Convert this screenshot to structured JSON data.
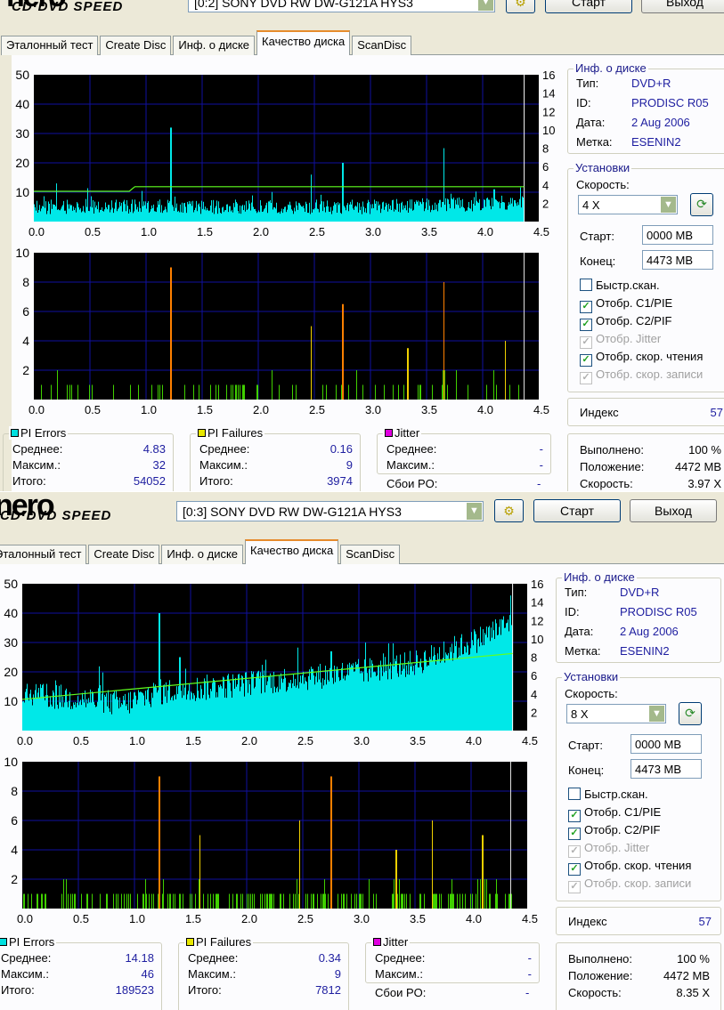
{
  "panels": [
    {
      "logo": "nero",
      "logo_sub": "CD·DVD SPEED",
      "drive": "[0:2]  SONY DVD RW DW-G121A HYS3",
      "start_btn": "Старт",
      "exit_btn": "Выход",
      "tabs": [
        "Эталонный тест",
        "Create Disc",
        "Инф. о диске",
        "Качество диска",
        "ScanDisc"
      ],
      "active_tab": 3,
      "info": {
        "title": "Инф. о диске",
        "type_l": "Тип:",
        "type": "DVD+R",
        "id_l": "ID:",
        "id": "PRODISC R05",
        "date_l": "Дата:",
        "date": "2 Aug 2006",
        "label_l": "Метка:",
        "label": "ESENIN2"
      },
      "settings": {
        "title": "Установки",
        "speed_l": "Скорость:",
        "speed": "4 X",
        "start_l": "Старт:",
        "start": "0000 MB",
        "end_l": "Конец:",
        "end": "4473 MB",
        "checks": [
          {
            "label": "Быстр.скан.",
            "checked": false,
            "disabled": false
          },
          {
            "label": "Отобр. C1/PIE",
            "checked": true,
            "disabled": false
          },
          {
            "label": "Отобр. C2/PIF",
            "checked": true,
            "disabled": false
          },
          {
            "label": "Отобр. Jitter",
            "checked": true,
            "disabled": true
          },
          {
            "label": "Отобр. скор. чтения",
            "checked": true,
            "disabled": false
          },
          {
            "label": "Отобр. скор. записи",
            "checked": true,
            "disabled": true
          }
        ]
      },
      "index_l": "Индекс",
      "index": "57",
      "progress": {
        "done_l": "Выполнено:",
        "done": "100 %",
        "pos_l": "Положение:",
        "pos": "4472 MB",
        "spd_l": "Скорость:",
        "spd": "3.97 X"
      },
      "pie": {
        "title": "PI Errors",
        "avg_l": "Среднее:",
        "avg": "4.83",
        "max_l": "Максим.:",
        "max": "32",
        "tot_l": "Итого:",
        "tot": "54052"
      },
      "pif": {
        "title": "PI Failures",
        "avg_l": "Среднее:",
        "avg": "0.16",
        "max_l": "Максим.:",
        "max": "9",
        "tot_l": "Итого:",
        "tot": "3974"
      },
      "jit": {
        "title": "Jitter",
        "avg_l": "Среднее:",
        "avg": "-",
        "max_l": "Максим.:",
        "max": "-",
        "po_l": "Сбои PO:",
        "po": "-"
      }
    },
    {
      "logo": "nero",
      "logo_sub": "CD·DVD SPEED",
      "drive": "[0:3]  SONY DVD RW DW-G121A HYS3",
      "start_btn": "Старт",
      "exit_btn": "Выход",
      "tabs": [
        "Эталонный тест",
        "Create Disc",
        "Инф. о диске",
        "Качество диска",
        "ScanDisc"
      ],
      "active_tab": 3,
      "info": {
        "title": "Инф. о диске",
        "type_l": "Тип:",
        "type": "DVD+R",
        "id_l": "ID:",
        "id": "PRODISC R05",
        "date_l": "Дата:",
        "date": "2 Aug 2006",
        "label_l": "Метка:",
        "label": "ESENIN2"
      },
      "settings": {
        "title": "Установки",
        "speed_l": "Скорость:",
        "speed": "8 X",
        "start_l": "Старт:",
        "start": "0000 MB",
        "end_l": "Конец:",
        "end": "4473 MB",
        "checks": [
          {
            "label": "Быстр.скан.",
            "checked": false,
            "disabled": false
          },
          {
            "label": "Отобр. C1/PIE",
            "checked": true,
            "disabled": false
          },
          {
            "label": "Отобр. C2/PIF",
            "checked": true,
            "disabled": false
          },
          {
            "label": "Отобр. Jitter",
            "checked": true,
            "disabled": true
          },
          {
            "label": "Отобр. скор. чтения",
            "checked": true,
            "disabled": false
          },
          {
            "label": "Отобр. скор. записи",
            "checked": true,
            "disabled": true
          }
        ]
      },
      "index_l": "Индекс",
      "index": "57",
      "progress": {
        "done_l": "Выполнено:",
        "done": "100 %",
        "pos_l": "Положение:",
        "pos": "4472 MB",
        "spd_l": "Скорость:",
        "spd": "8.35 X"
      },
      "pie": {
        "title": "PI Errors",
        "avg_l": "Среднее:",
        "avg": "14.18",
        "max_l": "Максим.:",
        "max": "46",
        "tot_l": "Итого:",
        "tot": "189523"
      },
      "pif": {
        "title": "PI Failures",
        "avg_l": "Среднее:",
        "avg": "0.34",
        "max_l": "Максим.:",
        "max": "9",
        "tot_l": "Итого:",
        "tot": "7812"
      },
      "jit": {
        "title": "Jitter",
        "avg_l": "Среднее:",
        "avg": "-",
        "max_l": "Максим.:",
        "max": "-",
        "po_l": "Сбои PO:",
        "po": "-"
      }
    }
  ],
  "chart_data": [
    {
      "type": "bar",
      "title": "PI Errors / read speed (4 X scan)",
      "xlim": [
        0,
        4.5
      ],
      "ylim": [
        0,
        50
      ],
      "y2lim": [
        0,
        16
      ],
      "xticks": [
        "0.0",
        "0.5",
        "1.0",
        "1.5",
        "2.0",
        "2.5",
        "3.0",
        "3.5",
        "4.0",
        "4.5"
      ],
      "yticks": [
        "10",
        "20",
        "30",
        "40",
        "50"
      ],
      "y2ticks": [
        "2",
        "4",
        "6",
        "8",
        "10",
        "12",
        "14",
        "16"
      ],
      "data_end": 4.37,
      "baseline": [
        [
          0,
          5
        ],
        [
          1,
          5
        ],
        [
          2,
          5
        ],
        [
          3,
          5
        ],
        [
          4,
          6
        ],
        [
          4.37,
          7
        ]
      ],
      "noise": 5,
      "spikes": [
        [
          0.2,
          13
        ],
        [
          1.22,
          32
        ],
        [
          2.47,
          16
        ],
        [
          2.75,
          20
        ],
        [
          3.65,
          25
        ],
        [
          4.1,
          11
        ]
      ],
      "speed": [
        [
          0,
          3.3
        ],
        [
          0.85,
          3.3
        ],
        [
          0.9,
          3.8
        ],
        [
          4.37,
          3.8
        ]
      ]
    },
    {
      "type": "bar",
      "title": "PI Failures (4 X scan)",
      "xlim": [
        0,
        4.5
      ],
      "ylim": [
        0,
        10
      ],
      "xticks": [
        "0.0",
        "0.5",
        "1.0",
        "1.5",
        "2.0",
        "2.5",
        "3.0",
        "3.5",
        "4.0",
        "4.5"
      ],
      "yticks": [
        "2",
        "4",
        "6",
        "8",
        "10"
      ],
      "data_end": 4.37,
      "density": 0.12,
      "spikes": [
        [
          1.22,
          9
        ],
        [
          2.47,
          5
        ],
        [
          2.75,
          6.5
        ],
        [
          3.33,
          3.5
        ],
        [
          3.65,
          8
        ],
        [
          4.2,
          4
        ],
        [
          4.37,
          10
        ]
      ]
    },
    {
      "type": "bar",
      "title": "PI Errors / read speed (8 X scan)",
      "xlim": [
        0,
        4.5
      ],
      "ylim": [
        0,
        50
      ],
      "y2lim": [
        0,
        16
      ],
      "xticks": [
        "0.0",
        "0.5",
        "1.0",
        "1.5",
        "2.0",
        "2.5",
        "3.0",
        "3.5",
        "4.0",
        "4.5"
      ],
      "yticks": [
        "10",
        "20",
        "30",
        "40",
        "50"
      ],
      "y2ticks": [
        "2",
        "4",
        "6",
        "8",
        "10",
        "12",
        "14",
        "16"
      ],
      "data_end": 4.37,
      "baseline": [
        [
          0,
          12
        ],
        [
          0.5,
          11
        ],
        [
          0.9,
          9
        ],
        [
          1.2,
          13
        ],
        [
          2,
          16
        ],
        [
          3,
          20
        ],
        [
          3.5,
          23
        ],
        [
          4,
          30
        ],
        [
          4.37,
          37
        ]
      ],
      "noise": 9,
      "spikes": [
        [
          1.22,
          40
        ],
        [
          1.4,
          25
        ],
        [
          2.75,
          27
        ],
        [
          4.35,
          46
        ]
      ],
      "speed": [
        [
          0,
          3.4
        ],
        [
          4.37,
          8.4
        ]
      ]
    },
    {
      "type": "bar",
      "title": "PI Failures (8 X scan)",
      "xlim": [
        0,
        4.5
      ],
      "ylim": [
        0,
        10
      ],
      "xticks": [
        "0.0",
        "0.5",
        "1.0",
        "1.5",
        "2.0",
        "2.5",
        "3.0",
        "3.5",
        "4.0",
        "4.5"
      ],
      "yticks": [
        "2",
        "4",
        "6",
        "8",
        "10"
      ],
      "data_end": 4.37,
      "density": 0.3,
      "spikes": [
        [
          1.22,
          9
        ],
        [
          1.58,
          5
        ],
        [
          2.47,
          6
        ],
        [
          2.75,
          9
        ],
        [
          3.33,
          4
        ],
        [
          3.65,
          6
        ],
        [
          4.1,
          5
        ],
        [
          4.35,
          10
        ]
      ]
    }
  ]
}
